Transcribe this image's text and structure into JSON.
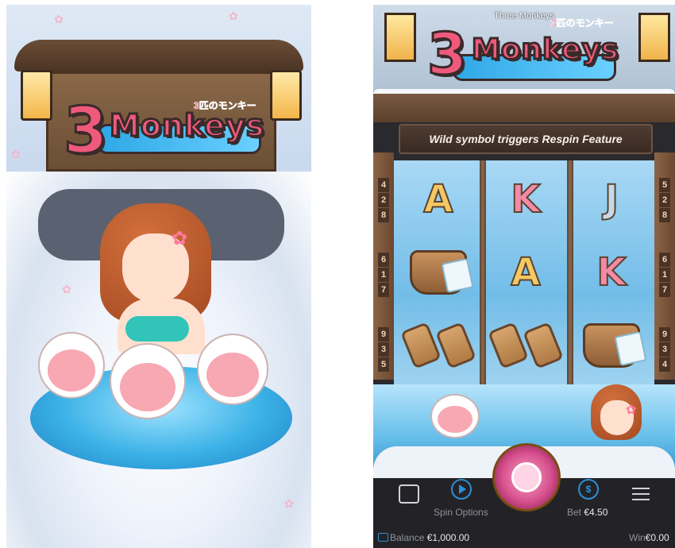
{
  "splash": {
    "logo_number": "3",
    "logo_word": "Monkeys",
    "logo_japanese": "3匹のモンキー"
  },
  "game": {
    "title": "Three Monkeys",
    "logo_number": "3",
    "logo_word": "Monkeys",
    "logo_japanese": "3匹のモンキー",
    "banner": "Wild symbol triggers Respin Feature",
    "left_numbers": [
      "4",
      "2",
      "8",
      "6",
      "1",
      "7",
      "9",
      "3",
      "5"
    ],
    "right_numbers": [
      "5",
      "2",
      "8",
      "6",
      "1",
      "7",
      "9",
      "3",
      "4"
    ],
    "reels": [
      [
        "A",
        "bucket",
        "geta"
      ],
      [
        "K",
        "A",
        "geta"
      ],
      [
        "J",
        "K",
        "bucket"
      ]
    ],
    "controls": {
      "spin_options_label": "Spin Options",
      "bet_label": "Bet",
      "bet_value": "€4.50",
      "balance_label": "Balance",
      "balance_value": "€1,000.00",
      "win_label": "Win",
      "win_value": "€0.00",
      "bet_icon": "$"
    }
  }
}
